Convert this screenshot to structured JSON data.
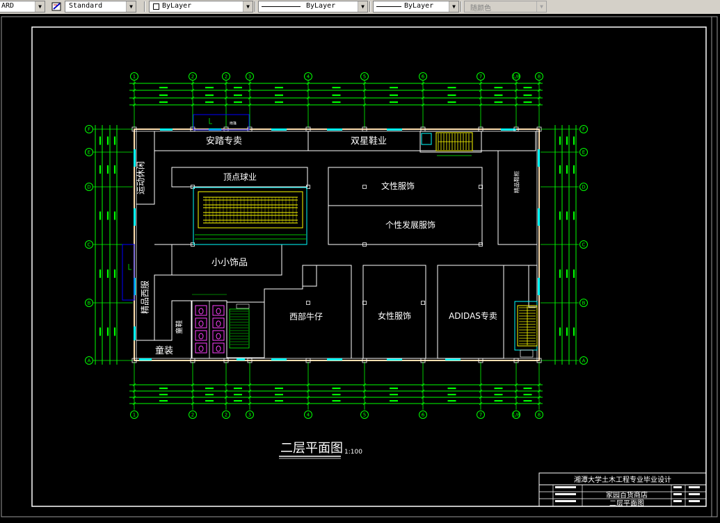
{
  "toolbar": {
    "textstyle_partial": "ARD",
    "style_value": "Standard",
    "layer_value": "ByLayer",
    "linetype_value": "ByLayer",
    "lineweight_value": "ByLayer",
    "color_value": "随颜色"
  },
  "drawing": {
    "title": "二层平面图",
    "scale": "1:100",
    "grid_top": [
      "1",
      "2",
      "2",
      "3",
      "4",
      "5",
      "6",
      "7",
      "1/8",
      "8"
    ],
    "grid_left": [
      "A",
      "B",
      "C",
      "D",
      "E",
      "F"
    ],
    "rooms": {
      "r1": "安踏专卖",
      "r2": "双星鞋业",
      "r3": "运动休闲",
      "r4": "顶点球业",
      "r5": "文性服饰",
      "r6": "个性发展服饰",
      "r7": "小小饰品",
      "r8": "精品西服",
      "r9": "西部牛仔",
      "r10": "女性服饰",
      "r11": "ADIDAS专卖",
      "r12": "童装",
      "r13": "童鞋",
      "r14": "精品鞋柜"
    },
    "title_block": {
      "school": "湘潭大学土木工程专业毕业设计",
      "project": "家园百货商店",
      "sheet": "二层平面图"
    }
  }
}
